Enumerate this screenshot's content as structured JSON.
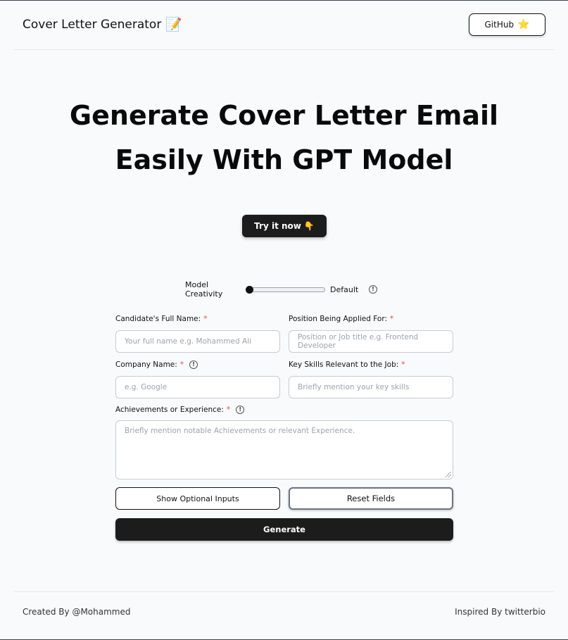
{
  "header": {
    "title": "Cover Letter Generator",
    "title_emoji": "📝",
    "github_label": "GitHub",
    "github_emoji": "⭐"
  },
  "hero": {
    "line1": "Generate Cover Letter Email",
    "line2": "Easily With GPT Model",
    "try_label": "Try it now",
    "try_emoji": "👇"
  },
  "creativity": {
    "label": "Model Creativity",
    "value_label": "Default",
    "level": 0.0,
    "info_icon": "info-icon"
  },
  "form": {
    "full_name": {
      "label": "Candidate's Full Name:",
      "required_mark": "*",
      "placeholder": "Your full name e.g. Mohammed Ali"
    },
    "position": {
      "label": "Position Being Applied For:",
      "required_mark": "*",
      "placeholder": "Position or Job title e.g. Frontend Developer"
    },
    "company": {
      "label": "Company Name:",
      "required_mark": "*",
      "placeholder": "e.g. Google"
    },
    "skills": {
      "label": "Key Skills Relevant to the Job:",
      "required_mark": "*",
      "placeholder": "Briefly mention your key skills"
    },
    "achievements": {
      "label": "Achievements or Experience:",
      "required_mark": "*",
      "placeholder": "Briefly mention notable Achievements or relevant Experience."
    },
    "optional_button": "Show Optional Inputs",
    "reset_button": "Reset Fields",
    "generate_button": "Generate"
  },
  "footer": {
    "left": "Created By @Mohammed",
    "right": "Inspired By twitterbio"
  },
  "colors": {
    "background": "#f8fafc",
    "dark_button": "#1c1c1c",
    "required": "#ef4444"
  }
}
